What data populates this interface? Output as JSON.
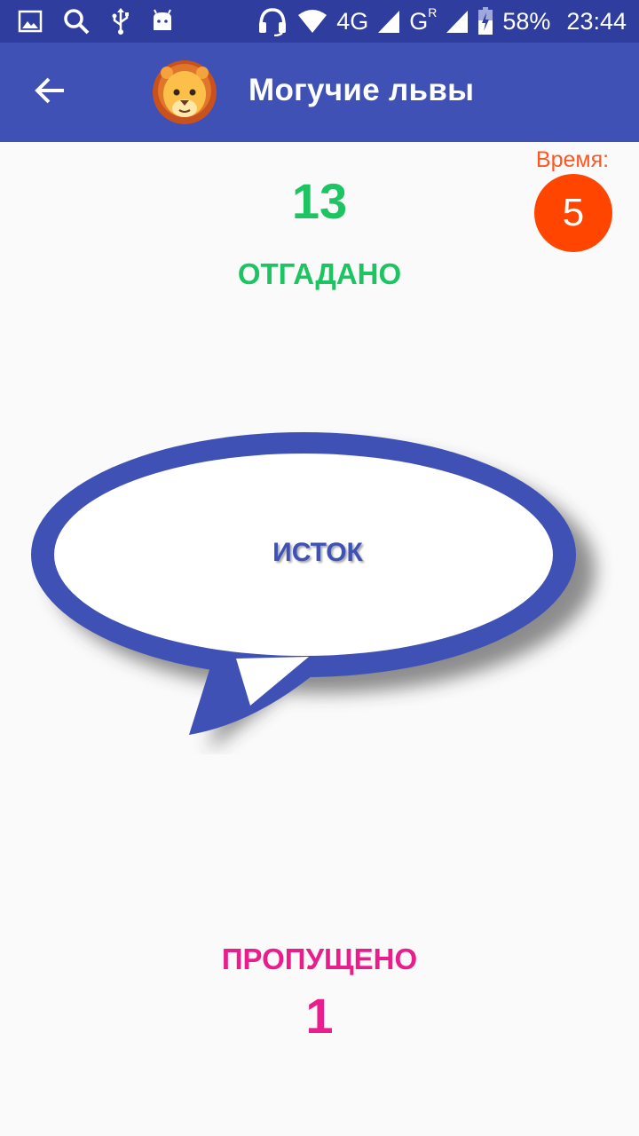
{
  "status_bar": {
    "battery": "58%",
    "time": "23:44",
    "network_1": "4G",
    "network_2": "G",
    "network_2_sup": "R",
    "icons": [
      "image-icon",
      "search-icon",
      "usb-icon",
      "android-icon",
      "headset-icon",
      "wifi-icon",
      "signal-icon",
      "signal-icon",
      "battery-icon"
    ]
  },
  "app_bar": {
    "title": "Могучие львы",
    "icons": [
      "back-arrow-icon",
      "lion-icon"
    ]
  },
  "timer": {
    "label": "Время:",
    "value": "5",
    "color": "#ff4500"
  },
  "guessed": {
    "count": "13",
    "label": "ОТГАДАНО",
    "color": "#1dc462"
  },
  "card": {
    "word": "ИСТОК",
    "border_color": "#3f51b5"
  },
  "skipped": {
    "label": "ПРОПУЩЕНО",
    "count": "1",
    "color": "#e91e8c"
  },
  "colors": {
    "primary": "#3f51b5",
    "primary_dark": "#2f3d9e",
    "background": "#fafafa"
  }
}
